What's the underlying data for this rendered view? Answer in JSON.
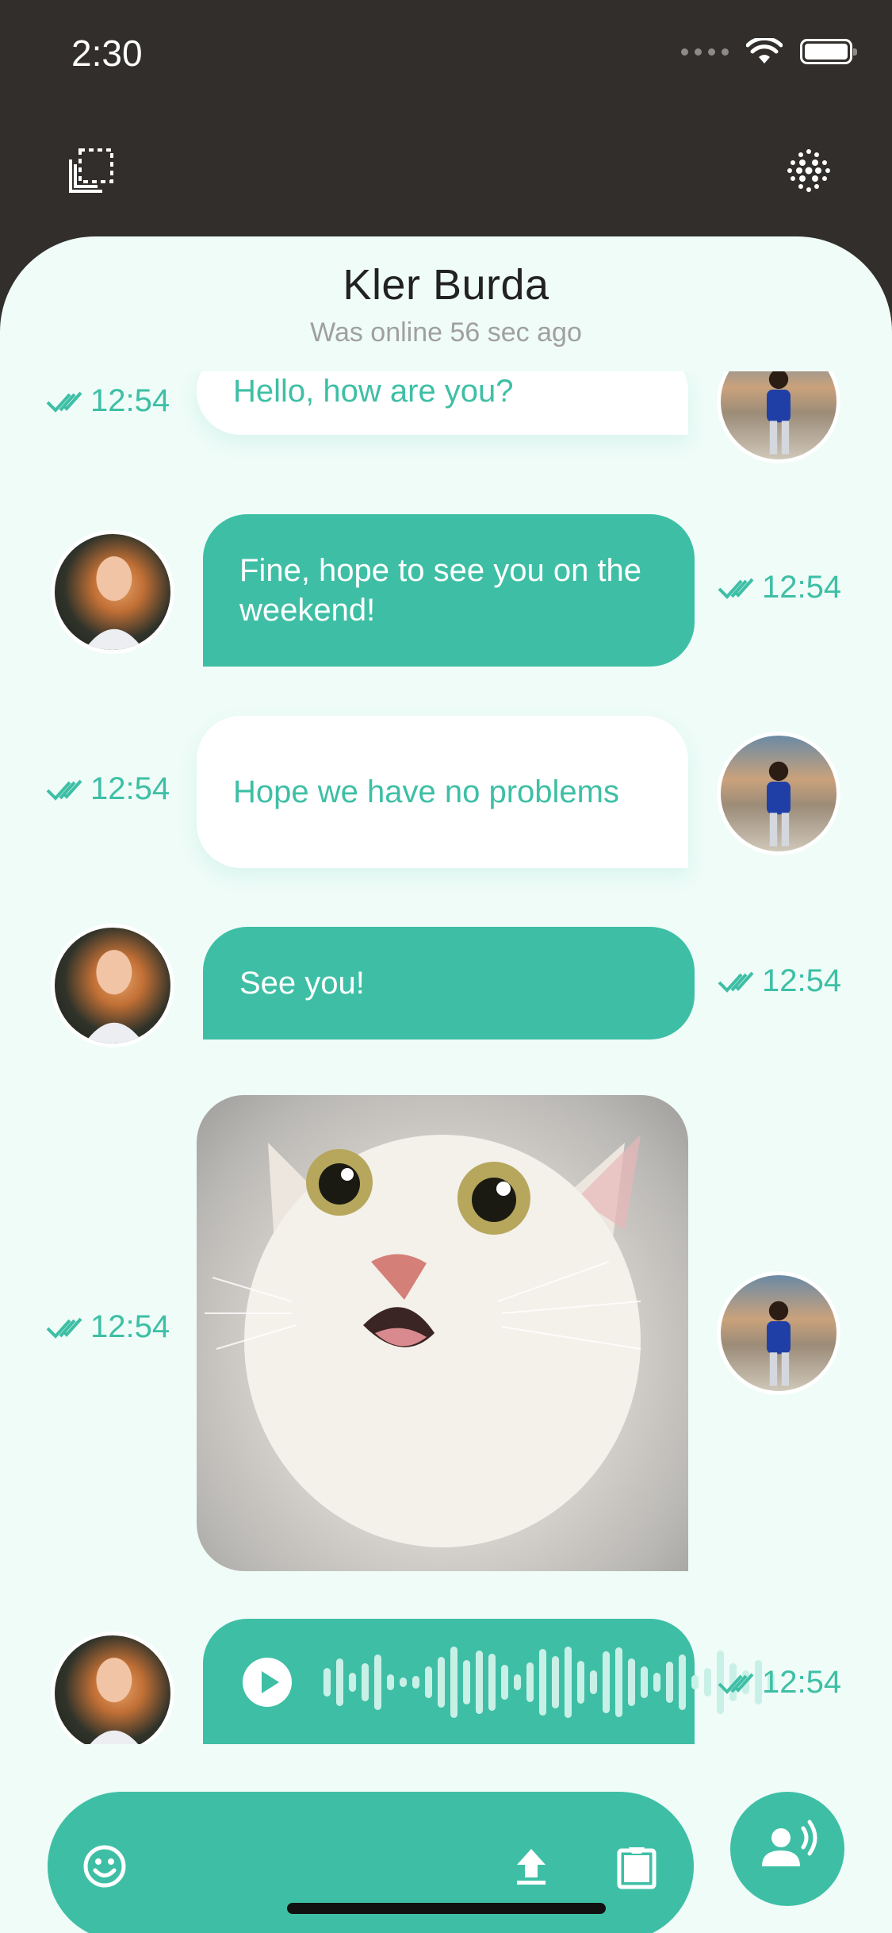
{
  "status_bar": {
    "time": "2:30"
  },
  "header": {
    "contact_name": "Kler Burda",
    "contact_status": "Was online 56 sec ago",
    "left_icon": "copy-icon",
    "right_icon": "dots-grid-icon"
  },
  "messages": [
    {
      "sender": "me",
      "type": "text",
      "text": "Hello, how are you?",
      "time": "12:54"
    },
    {
      "sender": "contact",
      "type": "text",
      "text": "Fine, hope to see you on the weekend!",
      "time": "12:54"
    },
    {
      "sender": "me",
      "type": "text",
      "text": "Hope we have no problems",
      "time": "12:54"
    },
    {
      "sender": "contact",
      "type": "text",
      "text": "See you!",
      "time": "12:54"
    },
    {
      "sender": "me",
      "type": "image",
      "image": "cat-photo",
      "time": "12:54"
    },
    {
      "sender": "contact",
      "type": "voice",
      "time": "12:54"
    }
  ],
  "input_bar": {
    "emoji_icon": "emoji-icon",
    "upload_icon": "upload-icon",
    "attach_icon": "clipboard-icon",
    "voice_button_icon": "voice-speaker-icon"
  },
  "colors": {
    "accent": "#3ebfa5",
    "panel_bg": "#effcf8",
    "top_bg": "#312e2b"
  }
}
